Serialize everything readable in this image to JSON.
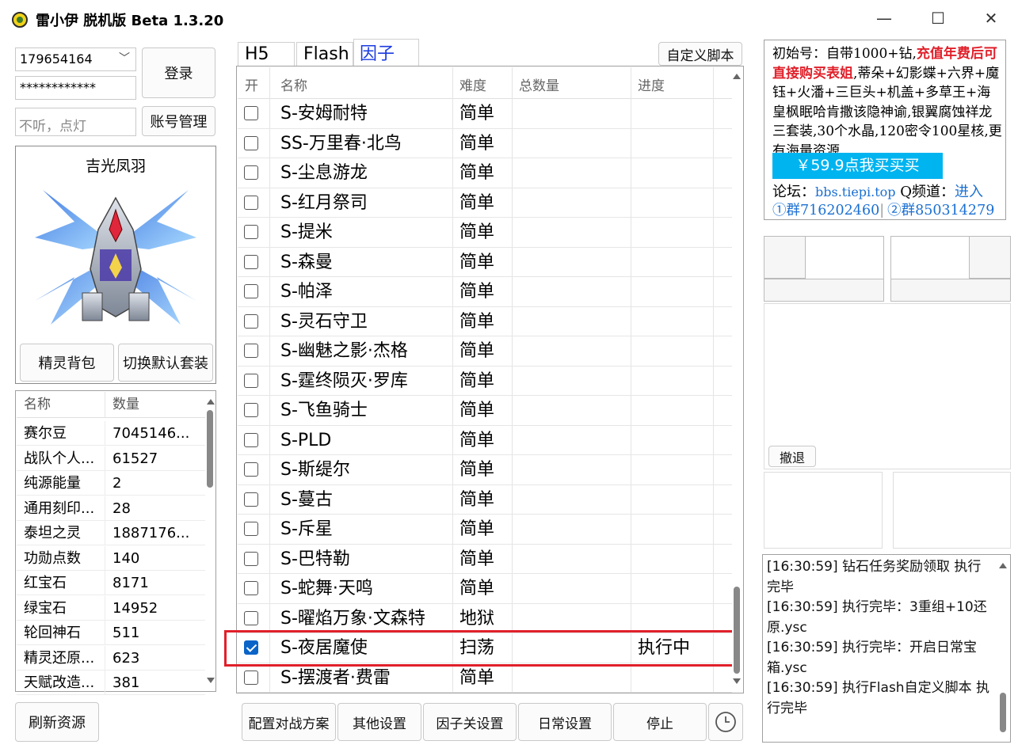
{
  "window": {
    "title": "雷小伊 脱机版 Beta 1.3.20",
    "minimize": "—",
    "maximize": "☐",
    "close": "✕"
  },
  "login": {
    "account": "179654164",
    "password": "************",
    "remark_placeholder": "不听，点灯",
    "login_btn": "登录",
    "account_mgr_btn": "账号管理"
  },
  "sprite": {
    "name": "吉光凤羽",
    "bag_btn": "精灵背包",
    "switch_btn": "切换默认套装"
  },
  "resources": {
    "headers": [
      "名称",
      "数量"
    ],
    "rows": [
      [
        "赛尔豆",
        "7045146..."
      ],
      [
        "战队个人...",
        "61527"
      ],
      [
        "纯源能量",
        "2"
      ],
      [
        "通用刻印...",
        "28"
      ],
      [
        "泰坦之灵",
        "1887176..."
      ],
      [
        "功勋点数",
        "140"
      ],
      [
        "红宝石",
        "8171"
      ],
      [
        "绿宝石",
        "14952"
      ],
      [
        "轮回神石",
        "511"
      ],
      [
        "精灵还原...",
        "623"
      ],
      [
        "天赋改造...",
        "381"
      ]
    ],
    "refresh_btn": "刷新资源"
  },
  "tabs": [
    {
      "label": "H5",
      "active": false
    },
    {
      "label": "Flash",
      "active": false
    },
    {
      "label": "因子",
      "active": true
    }
  ],
  "custom_script_btn": "自定义脚本",
  "grid": {
    "headers": [
      "开",
      "名称",
      "难度",
      "总数量",
      "进度"
    ],
    "rows": [
      {
        "checked": false,
        "name": "S-安姆耐特",
        "diff": "简单",
        "total": "",
        "progress": ""
      },
      {
        "checked": false,
        "name": "SS-万里春·北鸟",
        "diff": "简单",
        "total": "",
        "progress": ""
      },
      {
        "checked": false,
        "name": "S-尘息游龙",
        "diff": "简单",
        "total": "",
        "progress": ""
      },
      {
        "checked": false,
        "name": "S-红月祭司",
        "diff": "简单",
        "total": "",
        "progress": ""
      },
      {
        "checked": false,
        "name": "S-提米",
        "diff": "简单",
        "total": "",
        "progress": ""
      },
      {
        "checked": false,
        "name": "S-森曼",
        "diff": "简单",
        "total": "",
        "progress": ""
      },
      {
        "checked": false,
        "name": "S-帕泽",
        "diff": "简单",
        "total": "",
        "progress": ""
      },
      {
        "checked": false,
        "name": "S-灵石守卫",
        "diff": "简单",
        "total": "",
        "progress": ""
      },
      {
        "checked": false,
        "name": "S-幽魅之影·杰格",
        "diff": "简单",
        "total": "",
        "progress": ""
      },
      {
        "checked": false,
        "name": "S-霆终陨灭·罗库",
        "diff": "简单",
        "total": "",
        "progress": ""
      },
      {
        "checked": false,
        "name": "S-飞鱼骑士",
        "diff": "简单",
        "total": "",
        "progress": ""
      },
      {
        "checked": false,
        "name": "S-PLD",
        "diff": "简单",
        "total": "",
        "progress": ""
      },
      {
        "checked": false,
        "name": "S-斯缇尔",
        "diff": "简单",
        "total": "",
        "progress": ""
      },
      {
        "checked": false,
        "name": "S-蔓古",
        "diff": "简单",
        "total": "",
        "progress": ""
      },
      {
        "checked": false,
        "name": "S-斥星",
        "diff": "简单",
        "total": "",
        "progress": ""
      },
      {
        "checked": false,
        "name": "S-巴特勒",
        "diff": "简单",
        "total": "",
        "progress": ""
      },
      {
        "checked": false,
        "name": "S-蛇舞·天鸣",
        "diff": "简单",
        "total": "",
        "progress": ""
      },
      {
        "checked": false,
        "name": "S-曜焰万象·文森特",
        "diff": "地狱",
        "total": "",
        "progress": ""
      },
      {
        "checked": true,
        "name": "S-夜居魔使",
        "diff": "扫荡",
        "total": "",
        "progress": "执行中"
      },
      {
        "checked": false,
        "name": "S-摆渡者·费雷",
        "diff": "简单",
        "total": "",
        "progress": ""
      }
    ]
  },
  "bottom_buttons": [
    "配置对战方案",
    "其他设置",
    "因子关设置",
    "日常设置",
    "停止"
  ],
  "ad": {
    "part1": "初始号：自带1000+钻,",
    "part2_red": "充值年费后可直接购买表姐",
    "part3": ",蒂朵+幻影蝶+六界+魔钰+火潘+三巨头+机盖+多草王+海皇枫眠哈肯撒该隐神谕,银翼腐蚀祥龙三套装,30个水晶,120密令100星核,更有海量资源.",
    "buy_btn": "￥59.9点我买买买",
    "forum_label": "论坛：",
    "forum_url": "bbs.tiepi.top",
    "qchannel_label": " Q频道：",
    "qchannel_link": "进入",
    "group1": "①群716202460",
    "group2": "②群850314279"
  },
  "retreat_btn": "撤退",
  "log": [
    "[16:30:59] 钻石任务奖励领取 执行完毕",
    "[16:30:59] 执行完毕：3重组+10还原.ysc",
    "[16:30:59] 执行完毕：开启日常宝箱.ysc",
    "[16:30:59] 执行Flash自定义脚本 执行完毕"
  ],
  "colors": {
    "accent": "#0a64c8",
    "highlight": "#e0202a",
    "ad_btn": "#00b4f0",
    "link": "#1a6fd1"
  }
}
